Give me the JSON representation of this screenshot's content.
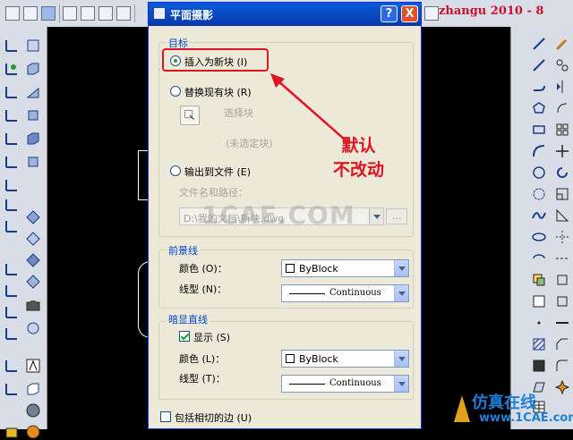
{
  "toolbar_watermark": "zhangu  2010 - 8",
  "dialog": {
    "title": "平面摄影",
    "help_label": "?",
    "close_label": "X",
    "target_group": {
      "label": "目标",
      "option_insert": "插入为新块 (I)",
      "option_replace": "替换现有块 (R)",
      "select_block_label": "选择块",
      "no_block_selected": "(未选定块)",
      "option_export": "输出到文件 (E)",
      "file_label": "文件名和路径：",
      "file_path": "D:\\我的文档\\新块.dwg",
      "browse_label": "..."
    },
    "foreground_group": {
      "label": "前景线",
      "color_label": "颜色 (O)：",
      "color_value": "ByBlock",
      "linetype_label": "线型 (N)：",
      "linetype_value": "Continuous"
    },
    "hidden_group": {
      "label": "暗显直线",
      "show_label": "显示 (S)",
      "color_label": "颜色 (L)：",
      "color_value": "ByBlock",
      "linetype_label": "线型 (T)：",
      "linetype_value": "Continuous"
    },
    "tangent_label": "包括相切的边 (U)"
  },
  "annotation": {
    "line1": "默认",
    "line2": "不改动"
  },
  "center_watermark": "1CAE.COM",
  "logo": {
    "chinese": "仿真在线",
    "url": "www.1CAE.com"
  },
  "colors": {
    "annotation_red": "#e0141e",
    "title_blue": "#0847c0",
    "group_label_blue": "#0046d5",
    "logo_blue": "#1d7fd6"
  }
}
